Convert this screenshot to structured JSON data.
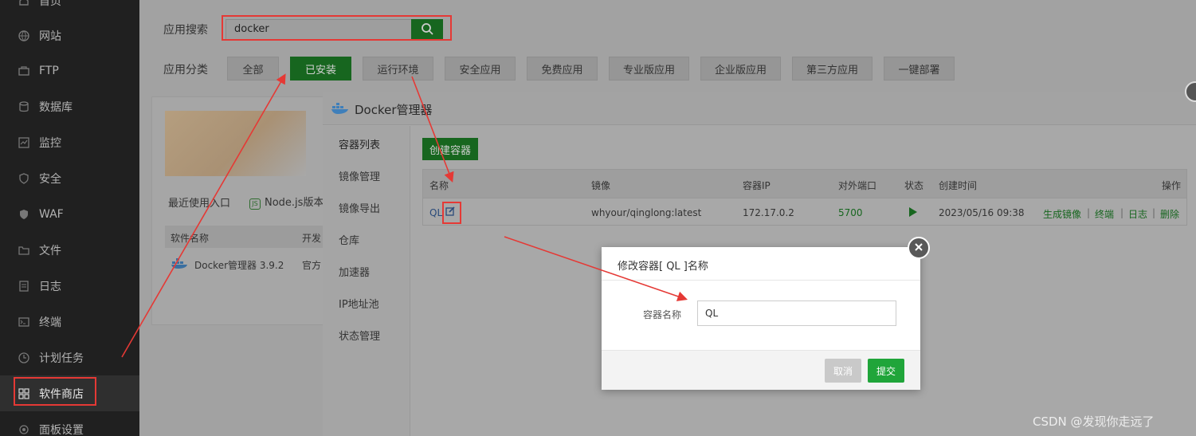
{
  "sidebar": {
    "items": [
      {
        "label": "首页",
        "icon": "home-icon"
      },
      {
        "label": "网站",
        "icon": "globe-icon"
      },
      {
        "label": "FTP",
        "icon": "ftp-icon"
      },
      {
        "label": "数据库",
        "icon": "database-icon"
      },
      {
        "label": "监控",
        "icon": "monitor-icon"
      },
      {
        "label": "安全",
        "icon": "shield-icon"
      },
      {
        "label": "WAF",
        "icon": "waf-icon"
      },
      {
        "label": "文件",
        "icon": "folder-icon"
      },
      {
        "label": "日志",
        "icon": "log-icon"
      },
      {
        "label": "终端",
        "icon": "terminal-icon"
      },
      {
        "label": "计划任务",
        "icon": "clock-icon"
      },
      {
        "label": "软件商店",
        "icon": "apps-icon",
        "active": true
      },
      {
        "label": "面板设置",
        "icon": "settings-icon"
      }
    ]
  },
  "search": {
    "label": "应用搜索",
    "value": "docker"
  },
  "categories": {
    "label": "应用分类",
    "items": [
      "全部",
      "已安装",
      "运行环境",
      "安全应用",
      "免费应用",
      "专业版应用",
      "企业版应用",
      "第三方应用",
      "一键部署"
    ],
    "active_index": 1
  },
  "panel": {
    "recent_label": "最近使用入口",
    "recent_app": "Node.js版本管",
    "col_name": "软件名称",
    "col_dev": "开发",
    "row_name": "Docker管理器 3.9.2",
    "row_dev": "官方"
  },
  "docker": {
    "title": "Docker管理器",
    "nav": [
      "容器列表",
      "镜像管理",
      "镜像导出",
      "仓库",
      "加速器",
      "IP地址池",
      "状态管理"
    ],
    "create_button": "创建容器",
    "columns": [
      "名称",
      "镜像",
      "容器IP",
      "对外端口",
      "状态",
      "创建时间",
      "操作"
    ],
    "row": {
      "name": "QL",
      "image": "whyour/qinglong:latest",
      "ip": "172.17.0.2",
      "port": "5700",
      "created": "2023/05/16 09:38",
      "actions": [
        "生成镜像",
        "终端",
        "日志",
        "删除"
      ],
      "sep": "|"
    }
  },
  "modal": {
    "title": "修改容器[ QL ]名称",
    "field_label": "容器名称",
    "field_value": "QL",
    "cancel": "取消",
    "submit": "提交"
  },
  "watermark": "CSDN @发现你走远了",
  "colors": {
    "accent": "#20a53a",
    "annotation": "#e53935"
  }
}
